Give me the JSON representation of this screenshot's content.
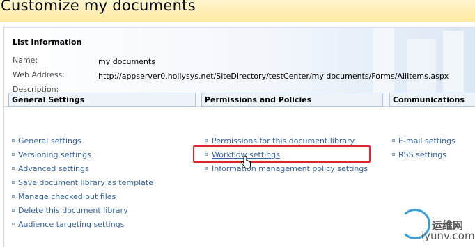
{
  "page": {
    "title": "Customize my documents"
  },
  "list_information": {
    "heading": "List Information",
    "name_label": "Name:",
    "name_value": "my documents",
    "web_address_label": "Web Address:",
    "web_address_value": "http://appserver0.hollysys.net/SiteDirectory/testCenter/my documents/Forms/AllItems.aspx",
    "description_label": "Description:"
  },
  "general_settings": {
    "heading": "General Settings",
    "items": [
      "General settings",
      "Versioning settings",
      "Advanced settings",
      "Save document library as template",
      "Manage checked out files",
      "Delete this document library",
      "Audience targeting settings"
    ]
  },
  "permissions": {
    "heading": "Permissions and Policies",
    "items": [
      "Permissions for this document library",
      "Workflow settings",
      "Information management policy settings"
    ]
  },
  "communications": {
    "heading": "Communications",
    "items": [
      "E-mail settings",
      "RSS settings"
    ]
  },
  "watermark": {
    "line1": "运维网",
    "line2": "iyunv.com"
  },
  "colors": {
    "title_band": "#ffe9a0",
    "link": "#3764a0",
    "highlight_box": "#d9282f"
  }
}
